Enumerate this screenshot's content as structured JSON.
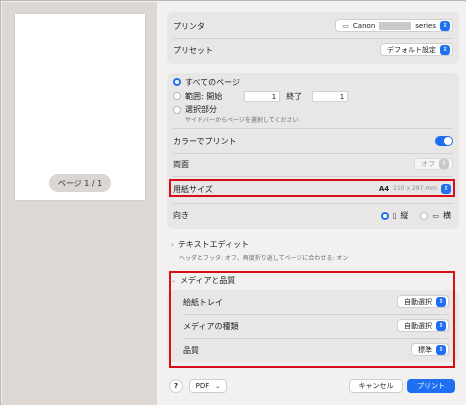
{
  "preview": {
    "page_label": "ページ 1 / 1"
  },
  "top": {
    "printer_label": "プリンタ",
    "printer_value": "Canon",
    "printer_series": "series",
    "preset_label": "プリセット",
    "preset_value": "デフォルト設定"
  },
  "pages": {
    "all_label": "すべてのページ",
    "range_label": "範囲: 開始",
    "range_start": "1",
    "range_end_label": "終了",
    "range_end": "1",
    "selection_label": "選択部分",
    "selection_hint": "サイドバーからページを選択してください",
    "color_label": "カラーでプリント",
    "duplex_label": "両面",
    "duplex_value": "オフ",
    "paper_label": "用紙サイズ",
    "paper_value": "A4",
    "paper_dims": "210 x 297 mm",
    "orientation_label": "向き",
    "portrait_label": "縦",
    "landscape_label": "横"
  },
  "text_edit": {
    "title": "テキストエディット",
    "desc": "ヘッダとフッタ: オフ、再度折り返してページに合わせる: オン"
  },
  "media": {
    "title": "メディアと品質",
    "tray_label": "給紙トレイ",
    "tray_value": "自動選択",
    "type_label": "メディアの種類",
    "type_value": "自動選択",
    "quality_label": "品質",
    "quality_value": "標準"
  },
  "footer": {
    "help_label": "?",
    "pdf_label": "PDF",
    "cancel_label": "キャンセル",
    "print_label": "プリント"
  },
  "colors": {
    "accent": "#1f6ff2",
    "highlight": "#d6101a"
  }
}
